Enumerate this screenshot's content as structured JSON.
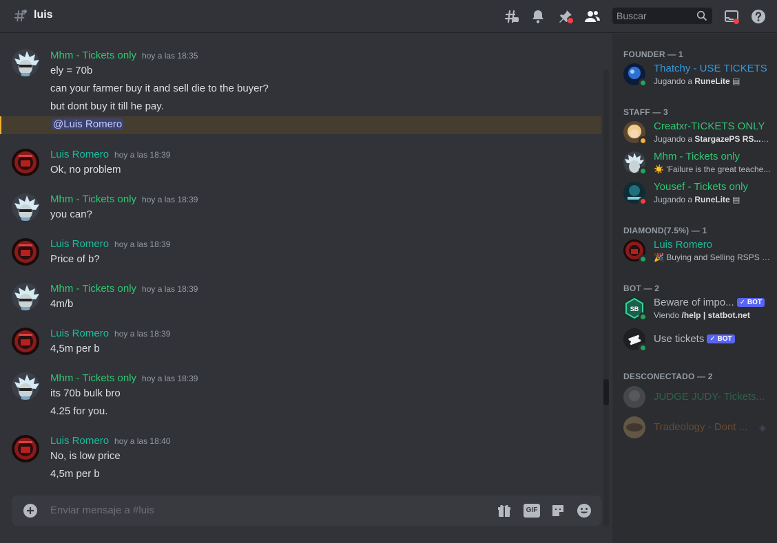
{
  "header": {
    "channel_name": "luis",
    "search_placeholder": "Buscar"
  },
  "messages": [
    {
      "author": "Mhm - Tickets only",
      "time": "hoy a las 18:35",
      "lines": [
        "ely = 70b",
        "can your farmer buy it and sell die to the buyer?",
        "but dont buy it till he pay."
      ],
      "mention": "@Luis Romero"
    },
    {
      "author": "Luis Romero",
      "time": "hoy a las 18:39",
      "lines": [
        "Ok, no problem"
      ]
    },
    {
      "author": "Mhm - Tickets only",
      "time": "hoy a las 18:39",
      "lines": [
        "you can?"
      ]
    },
    {
      "author": "Luis Romero",
      "time": "hoy a las 18:39",
      "lines": [
        "Price of b?"
      ]
    },
    {
      "author": "Mhm - Tickets only",
      "time": "hoy a las 18:39",
      "lines": [
        "4m/b"
      ]
    },
    {
      "author": "Luis Romero",
      "time": "hoy a las 18:39",
      "lines": [
        "4,5m per b"
      ]
    },
    {
      "author": "Mhm - Tickets only",
      "time": "hoy a las 18:39",
      "lines": [
        "its 70b bulk bro",
        "4.25 for you."
      ]
    },
    {
      "author": "Luis Romero",
      "time": "hoy a las 18:40",
      "lines": [
        "No, is low price",
        "4,5m per b"
      ]
    }
  ],
  "composer": {
    "placeholder": "Enviar mensaje a #luis",
    "gif_label": "GIF"
  },
  "members": {
    "categories": {
      "founder": "FOUNDER — 1",
      "staff": "STAFF — 3",
      "diamond": "DIAMOND(7.5%) — 1",
      "bot": "BOT — 2",
      "offline": "DESCONECTADO — 2"
    },
    "list": [
      {
        "name": "Thatchy - USE TICKETS",
        "activity_prefix": "Jugando a ",
        "activity": "RuneLite"
      },
      {
        "name": "Creatxr-TICKETS ONLY",
        "activity_prefix": "Jugando a ",
        "activity": "StargazePS RS..."
      },
      {
        "name": "Mhm - Tickets only",
        "activity_prefix": "",
        "activity": "☀️ 'Failure is the great teache..."
      },
      {
        "name": "Yousef - Tickets only",
        "activity_prefix": "Jugando a ",
        "activity": "RuneLite"
      },
      {
        "name": "Luis Romero",
        "activity_prefix": "",
        "activity": "🎉 Buying and Selling RSPS a..."
      },
      {
        "name": "Beware of impo...",
        "activity_prefix": "Viendo ",
        "activity": "/help | statbot.net"
      },
      {
        "name": "Use tickets",
        "activity_prefix": "",
        "activity": ""
      },
      {
        "name": "JUDGE JUDY- Tickets...",
        "activity_prefix": "",
        "activity": ""
      },
      {
        "name": "Tradeology - Dont ...",
        "activity_prefix": "",
        "activity": ""
      }
    ],
    "bot_tag": "BOT"
  },
  "colors": {
    "mhm": "#2dc770",
    "luis": "#1abc9c",
    "thatchy": "#3498db",
    "online": "#23a55a",
    "dnd": "#f23f43",
    "idle": "#f0b232"
  }
}
